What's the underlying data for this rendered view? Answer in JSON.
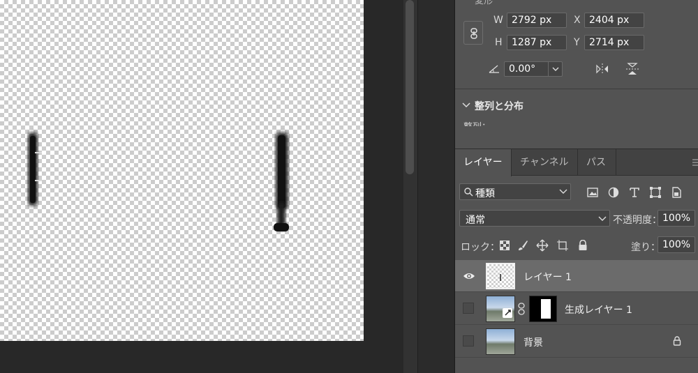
{
  "transform": {
    "title_partial": "変形",
    "w_label": "W",
    "w_value": "2792 px",
    "h_label": "H",
    "h_value": "1287 px",
    "x_label": "X",
    "x_value": "2404 px",
    "y_label": "Y",
    "y_value": "2714 px",
    "angle_value": "0.00°"
  },
  "align": {
    "title": "整列と分布",
    "sub_partial": "整列："
  },
  "layers_panel": {
    "tabs": [
      {
        "label": "レイヤー",
        "active": true
      },
      {
        "label": "チャンネル",
        "active": false
      },
      {
        "label": "パス",
        "active": false
      }
    ],
    "kind_filter": "種類",
    "blend_mode": "通常",
    "opacity_label": "不透明度：",
    "opacity_value": "100%",
    "lock_label": "ロック：",
    "fill_label": "塗り：",
    "fill_value": "100%",
    "layers": [
      {
        "name": "レイヤー 1",
        "visible": true,
        "selected": true,
        "type": "transparent"
      },
      {
        "name": "生成レイヤー 1",
        "visible": false,
        "selected": false,
        "type": "generated",
        "has_mask": true
      },
      {
        "name": "背景",
        "visible": false,
        "selected": false,
        "type": "background",
        "locked": true
      }
    ]
  },
  "colors": {
    "panel_bg": "#535353",
    "dark_bg": "#282828",
    "selected_row": "#6b6b6b",
    "field_bg": "#434343"
  }
}
